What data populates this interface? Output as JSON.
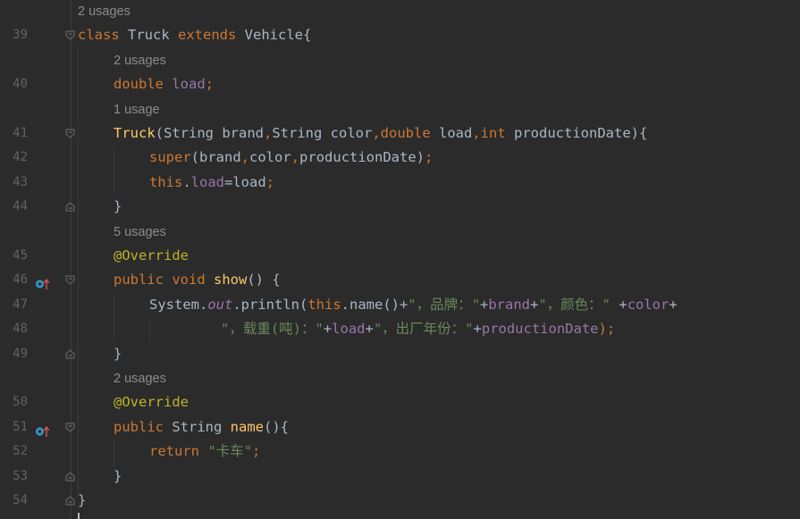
{
  "editor": {
    "lines": [
      {
        "num": "",
        "hint": "2 usages",
        "indent": 0
      },
      {
        "num": "39",
        "indent": 0,
        "fold": "open",
        "tokens": [
          {
            "t": "class ",
            "c": "kw"
          },
          {
            "t": "Truck ",
            "c": "pl"
          },
          {
            "t": "extends ",
            "c": "kw"
          },
          {
            "t": "Vehicle{",
            "c": "pl"
          }
        ]
      },
      {
        "num": "",
        "hint": "2 usages",
        "indent": 1
      },
      {
        "num": "40",
        "indent": 1,
        "tokens": [
          {
            "t": "double ",
            "c": "kw"
          },
          {
            "t": "load",
            "c": "fld"
          },
          {
            "t": ";",
            "c": "kw"
          }
        ]
      },
      {
        "num": "",
        "hint": "1 usage",
        "indent": 1
      },
      {
        "num": "41",
        "indent": 1,
        "fold": "open",
        "tokens": [
          {
            "t": "Truck",
            "c": "fn"
          },
          {
            "t": "(String brand",
            "c": "pl"
          },
          {
            "t": ",",
            "c": "kw"
          },
          {
            "t": "String color",
            "c": "pl"
          },
          {
            "t": ",",
            "c": "kw"
          },
          {
            "t": "double ",
            "c": "kw"
          },
          {
            "t": "load",
            "c": "pl"
          },
          {
            "t": ",",
            "c": "kw"
          },
          {
            "t": "int ",
            "c": "kw"
          },
          {
            "t": "productionDate){",
            "c": "pl"
          }
        ]
      },
      {
        "num": "42",
        "indent": 2,
        "tokens": [
          {
            "t": "super",
            "c": "kw"
          },
          {
            "t": "(brand",
            "c": "pl"
          },
          {
            "t": ",",
            "c": "kw"
          },
          {
            "t": "color",
            "c": "pl"
          },
          {
            "t": ",",
            "c": "kw"
          },
          {
            "t": "productionDate)",
            "c": "pl"
          },
          {
            "t": ";",
            "c": "kw"
          }
        ]
      },
      {
        "num": "43",
        "indent": 2,
        "tokens": [
          {
            "t": "this",
            "c": "kw"
          },
          {
            "t": ".",
            "c": "pl"
          },
          {
            "t": "load",
            "c": "fld"
          },
          {
            "t": "=load",
            "c": "pl"
          },
          {
            "t": ";",
            "c": "kw"
          }
        ]
      },
      {
        "num": "44",
        "indent": 1,
        "fold": "close",
        "tokens": [
          {
            "t": "}",
            "c": "pl"
          }
        ]
      },
      {
        "num": "",
        "hint": "5 usages",
        "indent": 1
      },
      {
        "num": "45",
        "indent": 1,
        "tokens": [
          {
            "t": "@Override",
            "c": "ann"
          }
        ]
      },
      {
        "num": "46",
        "indent": 1,
        "fold": "open",
        "override": true,
        "tokens": [
          {
            "t": "public ",
            "c": "kw"
          },
          {
            "t": "void ",
            "c": "kw"
          },
          {
            "t": "show",
            "c": "fn"
          },
          {
            "t": "() {",
            "c": "pl"
          }
        ]
      },
      {
        "num": "47",
        "indent": 2,
        "tokens": [
          {
            "t": "System.",
            "c": "pl"
          },
          {
            "t": "out",
            "c": "fldi"
          },
          {
            "t": ".println(",
            "c": "pl"
          },
          {
            "t": "this",
            "c": "kw"
          },
          {
            "t": ".name()+",
            "c": "pl"
          },
          {
            "t": "\"，品牌：\"",
            "c": "str"
          },
          {
            "t": "+",
            "c": "pl"
          },
          {
            "t": "brand",
            "c": "fld"
          },
          {
            "t": "+",
            "c": "pl"
          },
          {
            "t": "\"，颜色：\" ",
            "c": "str"
          },
          {
            "t": "+",
            "c": "pl"
          },
          {
            "t": "color",
            "c": "fld"
          },
          {
            "t": "+",
            "c": "pl"
          }
        ]
      },
      {
        "num": "48",
        "indent": 4,
        "tokens": [
          {
            "t": "\"，载重(吨)：\"",
            "c": "str"
          },
          {
            "t": "+",
            "c": "pl"
          },
          {
            "t": "load",
            "c": "fld"
          },
          {
            "t": "+",
            "c": "pl"
          },
          {
            "t": "\"，出厂年份：\"",
            "c": "str"
          },
          {
            "t": "+",
            "c": "pl"
          },
          {
            "t": "productionDate",
            "c": "fld"
          },
          {
            "t": ");",
            "c": "kw"
          }
        ]
      },
      {
        "num": "49",
        "indent": 1,
        "fold": "close",
        "tokens": [
          {
            "t": "}",
            "c": "pl"
          }
        ]
      },
      {
        "num": "",
        "hint": "2 usages",
        "indent": 1
      },
      {
        "num": "50",
        "indent": 1,
        "tokens": [
          {
            "t": "@Override",
            "c": "ann"
          }
        ]
      },
      {
        "num": "51",
        "indent": 1,
        "fold": "open",
        "override": true,
        "tokens": [
          {
            "t": "public ",
            "c": "kw"
          },
          {
            "t": "String ",
            "c": "pl"
          },
          {
            "t": "name",
            "c": "fn"
          },
          {
            "t": "(){",
            "c": "pl"
          }
        ]
      },
      {
        "num": "52",
        "indent": 2,
        "tokens": [
          {
            "t": "return ",
            "c": "kw"
          },
          {
            "t": "\"卡车\"",
            "c": "str"
          },
          {
            "t": ";",
            "c": "kw"
          }
        ]
      },
      {
        "num": "53",
        "indent": 1,
        "fold": "close",
        "tokens": [
          {
            "t": "}",
            "c": "pl"
          }
        ]
      },
      {
        "num": "54",
        "indent": 0,
        "fold": "close",
        "tokens": [
          {
            "t": "}",
            "c": "pl"
          }
        ]
      }
    ],
    "colors": {
      "background": "#2b2b2b",
      "keyword": "#cc7832",
      "field": "#9876aa",
      "method": "#ffc66d",
      "string": "#6a8759",
      "annotation": "#bbb529",
      "hint": "#8c8c8c",
      "line_number": "#606366"
    },
    "icons": {
      "fold_open": "fold-open-icon",
      "fold_close": "fold-close-icon",
      "override": "override-method-icon"
    }
  }
}
